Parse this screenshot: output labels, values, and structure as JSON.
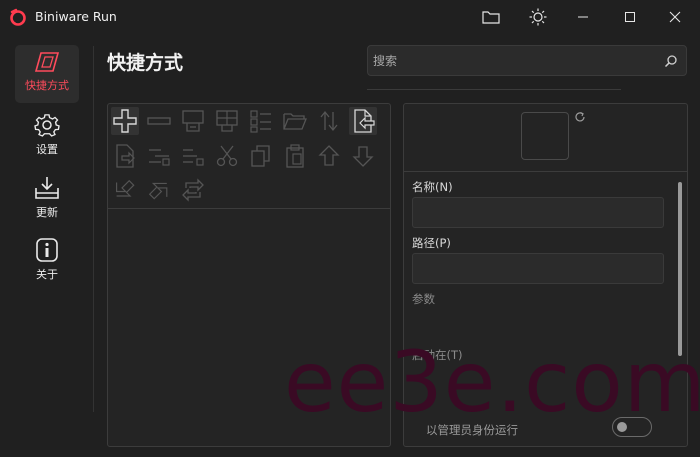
{
  "app": {
    "title": "Biniware Run",
    "accent_color": "#ff4b5c"
  },
  "titlebar": {
    "buttons": [
      {
        "icon": "folder-icon"
      },
      {
        "icon": "brightness-icon"
      },
      {
        "icon": "minimize-icon"
      },
      {
        "icon": "maximize-icon"
      },
      {
        "icon": "close-icon"
      }
    ]
  },
  "sidebar": {
    "items": [
      {
        "label": "快捷方式",
        "icon": "shortcut-icon",
        "active": true
      },
      {
        "label": "设置",
        "icon": "gear-icon",
        "active": false
      },
      {
        "label": "更新",
        "icon": "download-icon",
        "active": false
      },
      {
        "label": "关于",
        "icon": "info-icon",
        "active": false
      }
    ]
  },
  "main": {
    "title": "快捷方式",
    "search": {
      "placeholder": "搜索",
      "value": ""
    }
  },
  "toolbar": {
    "tools": [
      "add-icon",
      "remove-icon",
      "edit-icon",
      "grid-icon",
      "list-icon",
      "open-folder-icon",
      "sort-icon",
      "import-icon",
      "export-icon",
      "indent-icon",
      "outdent-icon",
      "cut-icon",
      "copy-icon",
      "paste-icon",
      "move-up-icon",
      "move-down-icon",
      "undo-icon",
      "redo-icon",
      "refresh-icon"
    ]
  },
  "details": {
    "name_label": "名称(N)",
    "name_value": "",
    "path_label": "路径(P)",
    "path_value": "",
    "args_label": "参数",
    "startin_label": "启动在(T)",
    "admin_label": "以管理员身份运行",
    "admin_enabled": false
  },
  "watermark": "ee3e.com"
}
